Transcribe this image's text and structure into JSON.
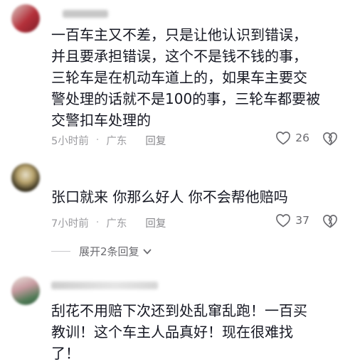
{
  "comments": [
    {
      "lines": [
        "一百车主又不差，只是让他认识到错误，",
        "并且要承担错误，这个不是钱不钱的事，",
        "三轮车是在机动车道上的，如果车主要交",
        "警处理的话就不是100的事，三轮车都要被",
        "交警扣车处理的"
      ],
      "time": "5小时前",
      "separator": "·",
      "location": "广东",
      "reply_label": "回复",
      "like_count": "26"
    },
    {
      "lines": [
        "张口就来 你那么好人 你不会帮他赔吗"
      ],
      "time": "7小时前",
      "separator": "·",
      "location": "广东",
      "reply_label": "回复",
      "like_count": "37",
      "expand_label": "展开2条回复"
    },
    {
      "lines": [
        "刮花不用赔下次还到处乱窜乱跑！一百买",
        "教训！这个车主人品真好！现在很难找",
        "了！"
      ]
    }
  ],
  "icons": {
    "like": "heart-outline-icon",
    "dislike": "broken-heart-icon",
    "expand": "chevron-down-icon"
  },
  "colors": {
    "text": "#161823",
    "meta": "#9b9b9f",
    "icon": "#6b6b70"
  }
}
